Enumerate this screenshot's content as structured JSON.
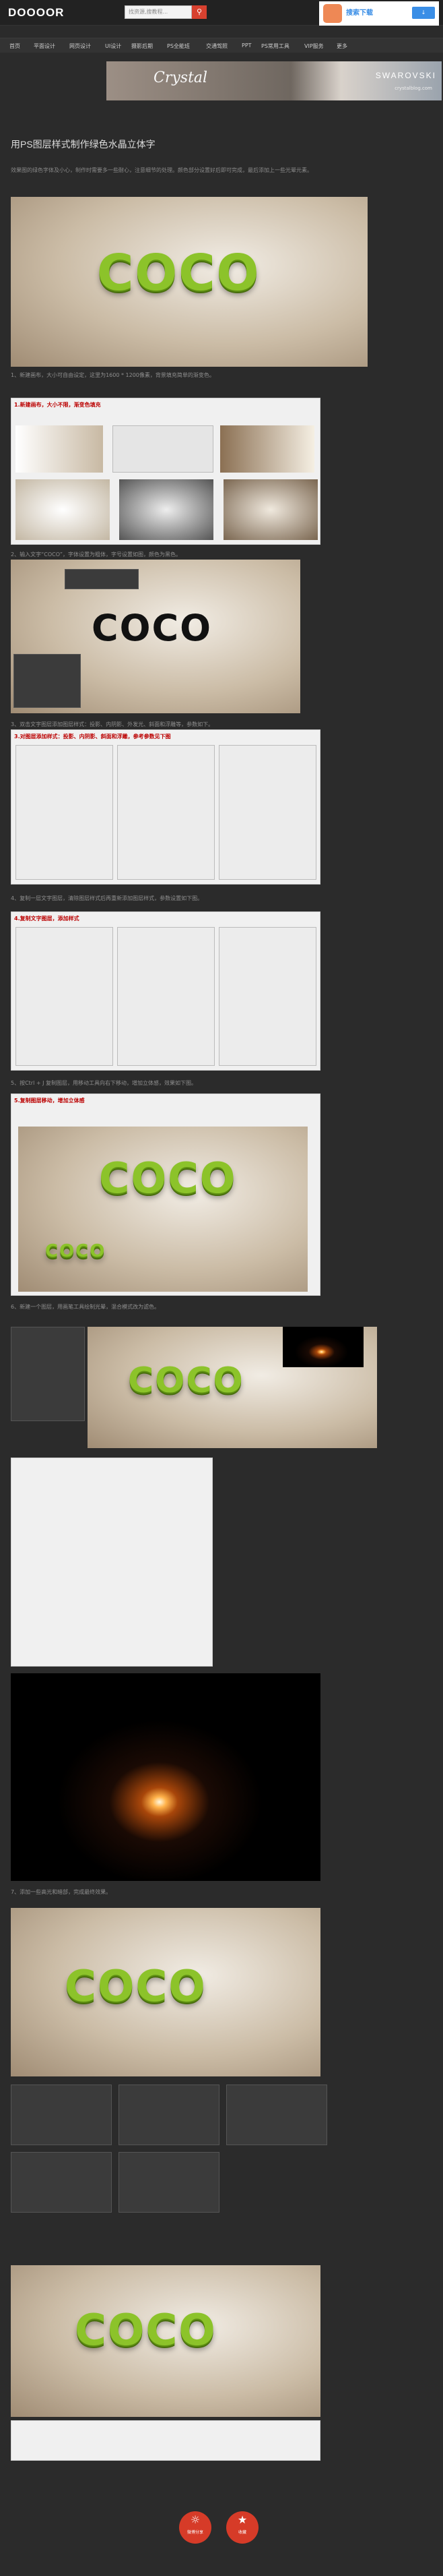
{
  "site": {
    "logo": "DOOOOR",
    "search_placeholder": "找资源,搜教程...",
    "search_icon": "search-icon"
  },
  "top_ad": {
    "text": "搜索下载"
  },
  "nav": {
    "items": [
      "首页",
      "平面设计",
      "网页设计",
      "UI设计",
      "摄影后期",
      "PS全能班",
      "交通驾照",
      "PPT",
      "PS常用工具",
      "VIP服务",
      "更多"
    ]
  },
  "banner": {
    "brand_script": "Crystal",
    "brand": "SWAROVSKI",
    "url": "crystalblog.com"
  },
  "article": {
    "title": "用PS图层样式制作绿色水晶立体字",
    "intro": "效果图的绿色字体及小心，制作时需要多一些耐心，注意细节的处理。颜色部分设置好后即可完成，最后添加上一些光晕元素。"
  },
  "steps": [
    {
      "text": "1、新建画布，大小可自由设定，这里为1600 * 1200像素，背景填充简单的渐变色。"
    },
    {
      "text": "2、输入文字“COCO”，字体设置为粗体，字号设置如图，颜色为黑色。"
    },
    {
      "text": "3、双击文字图层添加图层样式：投影、内阴影、外发光、斜面和浮雕等，参数如下。"
    },
    {
      "text": "4、复制一层文字图层，清除图层样式后再重新添加图层样式，参数设置如下图。"
    },
    {
      "text": "5、按Ctrl + J 复制图层，用移动工具向右下移动，增加立体感，效果如下图。"
    },
    {
      "text": "6、新建一个图层，用画笔工具绘制光晕，混合模式改为滤色。"
    },
    {
      "text": "7、添加一些高光和暗部，完成最终效果。"
    }
  ],
  "panel_headers": {
    "p1": "1.新建画布，大小不限，渐变色填充",
    "p3": "3.对图层添加样式：投影、内阴影、斜面和浮雕，参考参数见下图",
    "p4": "4.复制文字图层，添加样式",
    "p5": "5.复制图层移动，增加立体感"
  },
  "share": {
    "left_label": "微博分享",
    "right_label": "收藏",
    "left_icon": "weibo-icon",
    "right_icon": "star-icon"
  },
  "coco_word": "COCO"
}
